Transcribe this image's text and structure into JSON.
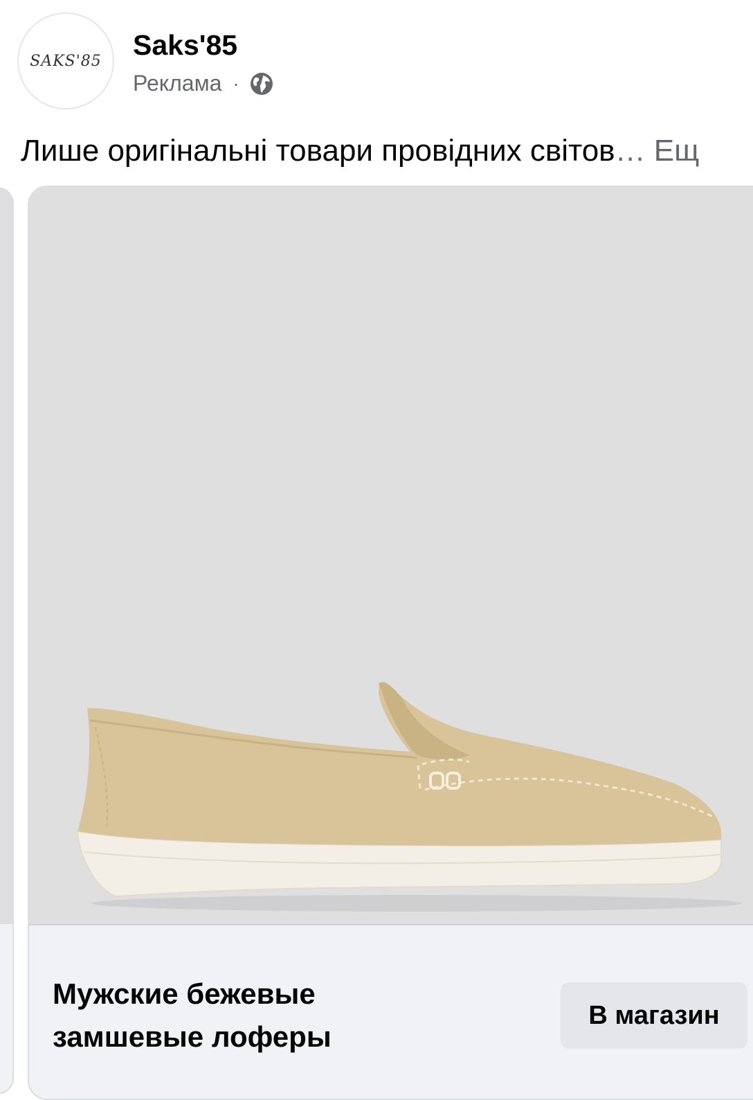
{
  "post": {
    "page_name": "Saks'85",
    "avatar_text": "SAKS'85",
    "sponsored_label": "Реклама",
    "separator": "·",
    "privacy_icon": "globe-icon",
    "caption": "Лише оригінальні товари провідних світов",
    "ellipsis": "…",
    "see_more": "Ещ"
  },
  "carousel": {
    "card": {
      "image_alt": "beige suede loafer",
      "title": "Мужские бежевые замшевые лоферы",
      "cta_label": "В магазин"
    }
  },
  "colors": {
    "secondary_text": "#65676b",
    "image_bg": "#dfdfe0",
    "footer_bg": "#f0f2f5",
    "button_bg": "#e4e6eb",
    "suede": "#d9c49a"
  }
}
